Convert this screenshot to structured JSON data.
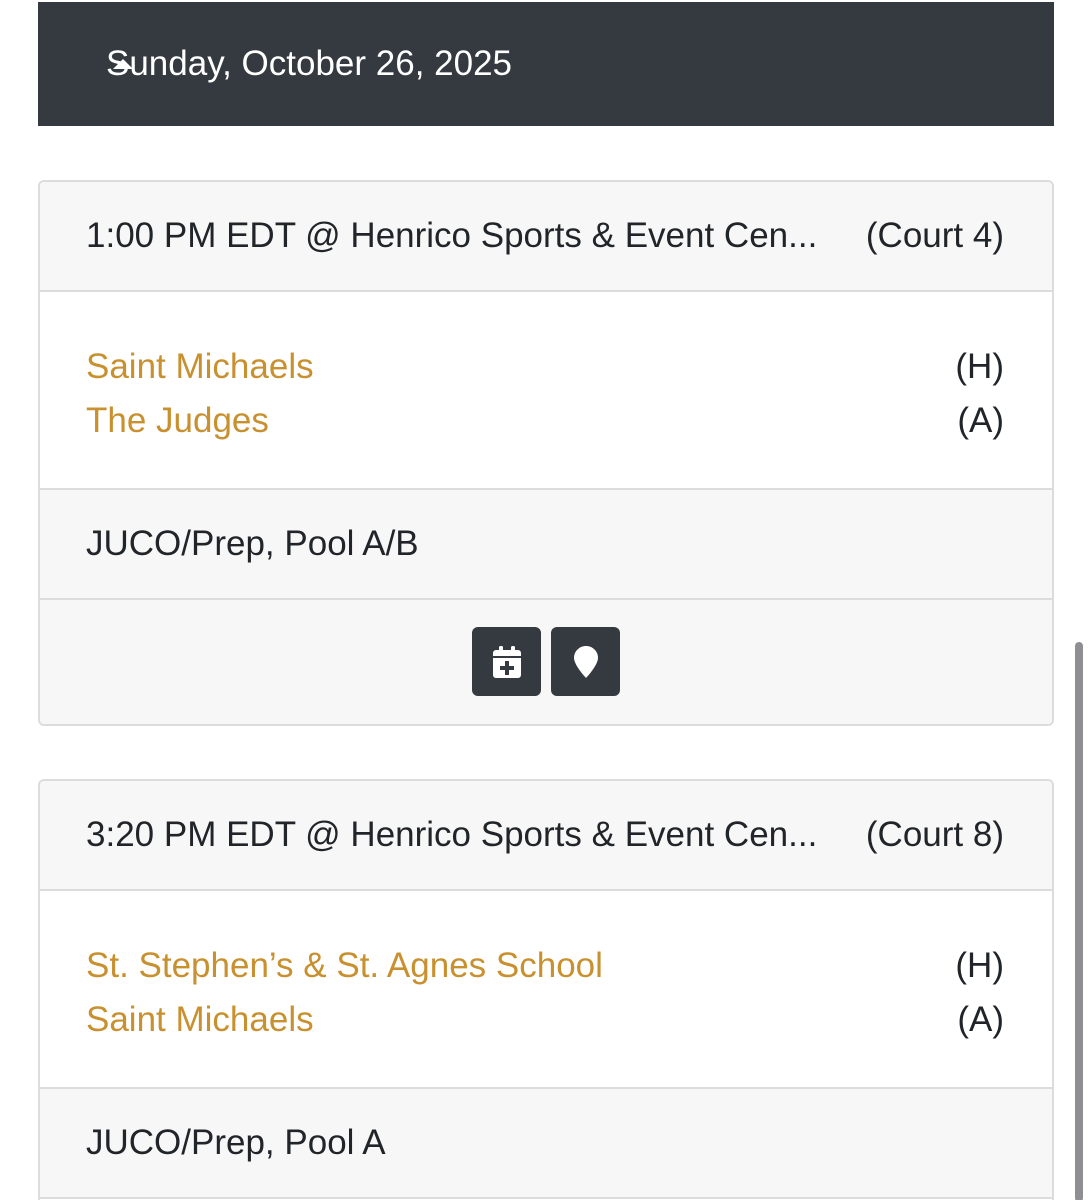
{
  "date_header": {
    "label": "Sunday, October 26, 2025",
    "toggle_icon": "caret-up-icon"
  },
  "games": [
    {
      "time_location": "1:00 PM EDT @ Henrico Sports & Event Cen...",
      "court": "(Court 4)",
      "home_team": "Saint Michaels",
      "home_marker": "(H)",
      "away_team": "The Judges",
      "away_marker": "(A)",
      "division": "JUCO/Prep, Pool A/B",
      "actions": [
        "calendar-plus-icon",
        "map-marker-icon"
      ]
    },
    {
      "time_location": "3:20 PM EDT @ Henrico Sports & Event Cen...",
      "court": "(Court 8)",
      "home_team": "St. Stephen’s & St. Agnes School",
      "home_marker": "(H)",
      "away_team": "Saint Michaels",
      "away_marker": "(A)",
      "division": "JUCO/Prep, Pool A"
    }
  ],
  "colors": {
    "header_bg": "#343a40",
    "team_link": "#c8902f",
    "card_bg": "#f7f7f7",
    "border": "#dcdcdc"
  }
}
